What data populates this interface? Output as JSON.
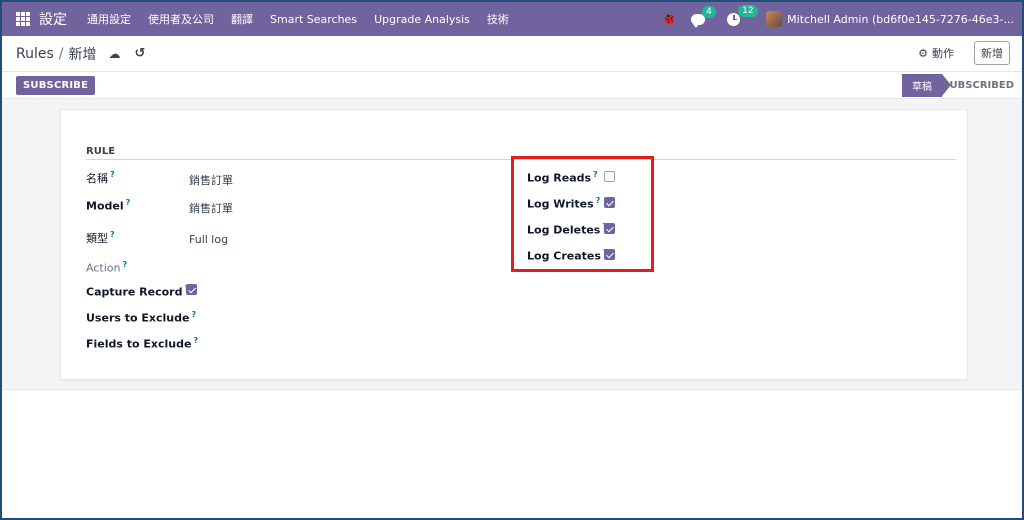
{
  "navbar": {
    "brand": "設定",
    "menu": [
      "通用設定",
      "使用者及公司",
      "翻譯",
      "Smart Searches",
      "Upgrade Analysis",
      "技術"
    ],
    "messages_count": "4",
    "activities_count": "12",
    "user": "Mitchell Admin (bd6f0e145-7276-46e3-..."
  },
  "control": {
    "breadcrumb_parent": "Rules",
    "breadcrumb_sep": "/",
    "breadcrumb_current": "新增",
    "action_label": "動作",
    "new_label": "新增"
  },
  "statusbar": {
    "subscribe_label": "SUBSCRIBE",
    "stage_draft": "草稿",
    "stage_subscribed": "SUBSCRIBED"
  },
  "form": {
    "section_title": "RULE",
    "q": "?",
    "name_label": "名稱",
    "name_value": "銷售訂單",
    "model_label": "Model",
    "model_value": "銷售訂單",
    "type_label": "類型",
    "type_value": "Full log",
    "action_label": "Action",
    "capture_label": "Capture Record",
    "capture_checked": true,
    "users_exclude_label": "Users to Exclude",
    "fields_exclude_label": "Fields to Exclude",
    "log_reads_label": "Log Reads",
    "log_reads_checked": false,
    "log_writes_label": "Log Writes",
    "log_writes_checked": true,
    "log_deletes_label": "Log Deletes",
    "log_deletes_checked": true,
    "log_creates_label": "Log Creates",
    "log_creates_checked": true
  },
  "colors": {
    "brand": "#71639e",
    "badge": "#21b799",
    "highlight": "#e11d1d"
  }
}
